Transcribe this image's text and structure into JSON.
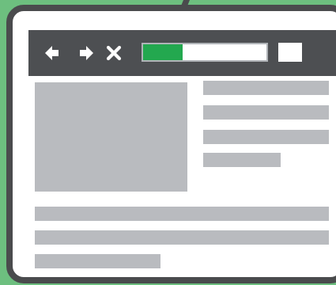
{
  "browser": {
    "loading_progress": 0.32,
    "accent_color": "#23a84f",
    "toolbar_color": "#4d4f52",
    "placeholder_color": "#b9bbbf",
    "background_color": "#6dbf7f"
  },
  "toolbar": {
    "back_icon": "arrow-left-icon",
    "forward_icon": "arrow-right-icon",
    "close_icon": "close-icon",
    "menu_icon": "menu-square-icon"
  }
}
